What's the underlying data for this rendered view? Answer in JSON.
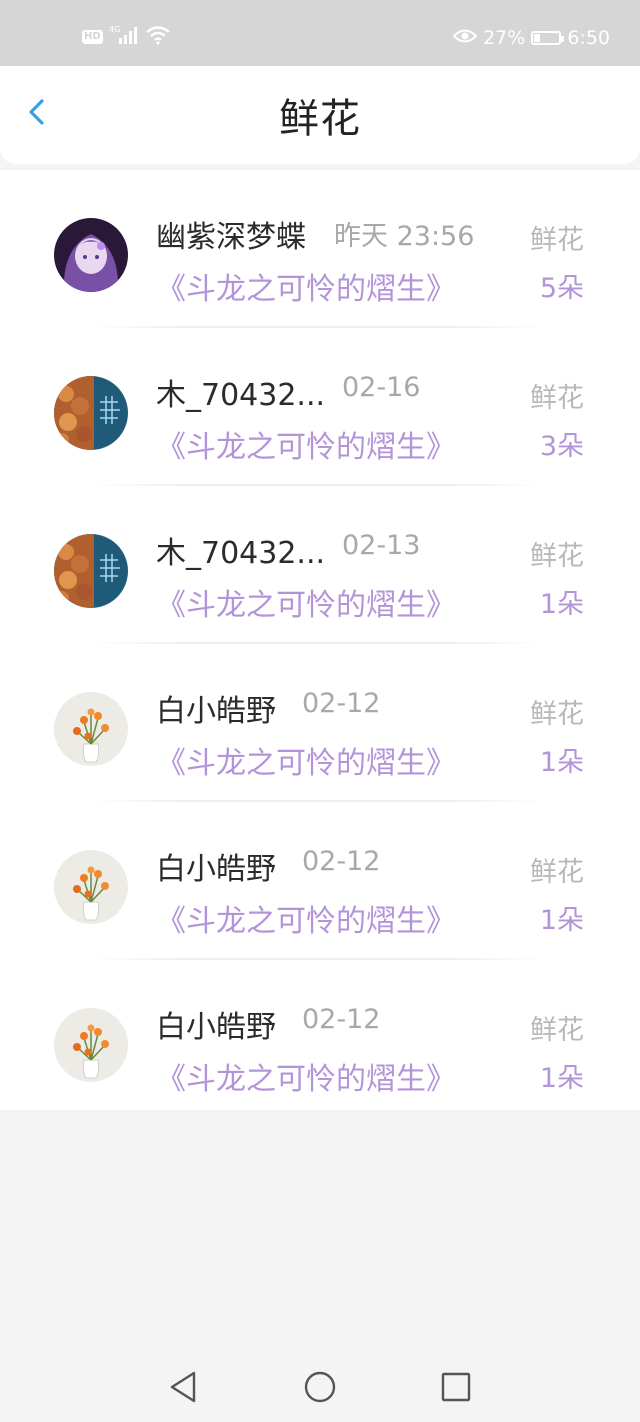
{
  "status_bar": {
    "hd_label": "HD",
    "network": "4G",
    "battery_percent": "27%",
    "battery_level": 0.27,
    "time": "6:50"
  },
  "header": {
    "title": "鲜花"
  },
  "gifts": [
    {
      "user": "幽紫深梦蝶",
      "time": "昨天 23:56",
      "book": "《斗龙之可怜的熠生》",
      "type": "鲜花",
      "count": "5朵",
      "avatar": "anime-girl-avatar"
    },
    {
      "user": "木_70432...",
      "time": "02-16",
      "book": "《斗龙之可怜的熠生》",
      "type": "鲜花",
      "count": "3朵",
      "avatar": "coral-avatar"
    },
    {
      "user": "木_70432...",
      "time": "02-13",
      "book": "《斗龙之可怜的熠生》",
      "type": "鲜花",
      "count": "1朵",
      "avatar": "coral-avatar"
    },
    {
      "user": "白小皓野",
      "time": "02-12",
      "book": "《斗龙之可怜的熠生》",
      "type": "鲜花",
      "count": "1朵",
      "avatar": "flower-vase-avatar"
    },
    {
      "user": "白小皓野",
      "time": "02-12",
      "book": "《斗龙之可怜的熠生》",
      "type": "鲜花",
      "count": "1朵",
      "avatar": "flower-vase-avatar"
    },
    {
      "user": "白小皓野",
      "time": "02-12",
      "book": "《斗龙之可怜的熠生》",
      "type": "鲜花",
      "count": "1朵",
      "avatar": "flower-vase-avatar"
    }
  ],
  "colors": {
    "accent_purple": "#b394d9",
    "back_arrow_blue": "#3a9ee6",
    "status_bar_bg": "#d6d6d6"
  }
}
